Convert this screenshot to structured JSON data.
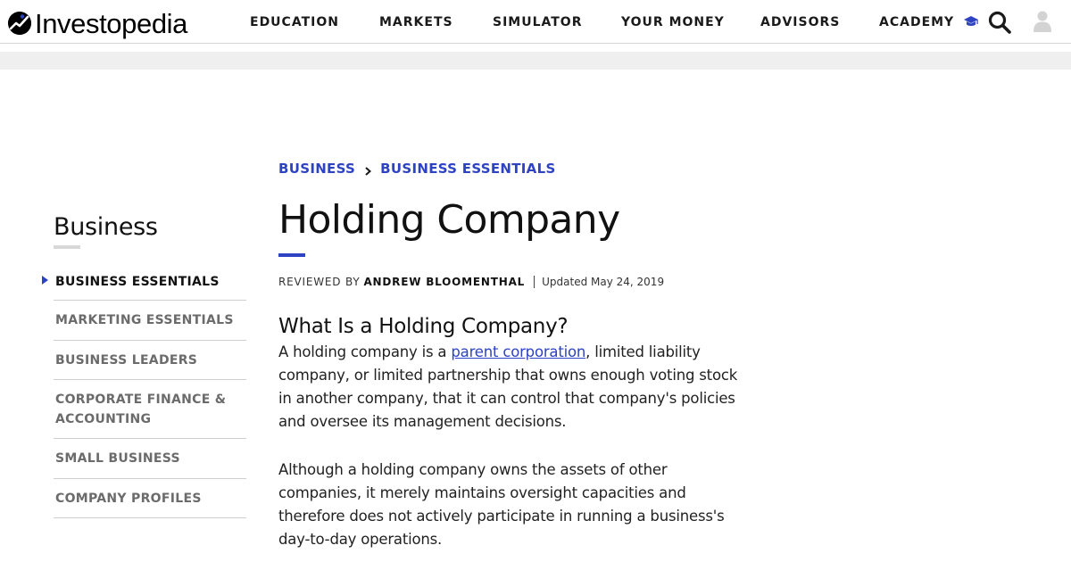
{
  "header": {
    "logo_text": "Investopedia",
    "nav": [
      {
        "label": "EDUCATION"
      },
      {
        "label": "MARKETS"
      },
      {
        "label": "SIMULATOR"
      },
      {
        "label": "YOUR MONEY"
      },
      {
        "label": "ADVISORS"
      },
      {
        "label": "ACADEMY"
      }
    ],
    "icons": {
      "academy": "graduation-cap-icon",
      "search": "search-icon",
      "user": "user-icon"
    },
    "colors": {
      "accent": "#2e42c4"
    }
  },
  "sidebar": {
    "title": "Business",
    "items": [
      {
        "label": "BUSINESS ESSENTIALS",
        "active": true
      },
      {
        "label": "MARKETING ESSENTIALS"
      },
      {
        "label": "BUSINESS LEADERS"
      },
      {
        "label": "CORPORATE FINANCE &",
        "label2": "ACCOUNTING"
      },
      {
        "label": "SMALL BUSINESS"
      },
      {
        "label": "COMPANY PROFILES"
      }
    ]
  },
  "article": {
    "breadcrumb": [
      "BUSINESS",
      "BUSINESS ESSENTIALS"
    ],
    "title": "Holding Company",
    "reviewed_by_label": "REVIEWED BY",
    "reviewer": "ANDREW BLOOMENTHAL",
    "updated": "Updated May 24, 2019",
    "section_heading": "What Is a Holding Company?",
    "para1_before": "A holding company is a ",
    "para1_link": "parent corporation",
    "para1_after": ", limited liability company, or limited partnership that owns enough voting stock in another company, that it can control that company's policies and oversee its management decisions.",
    "para2": "Although a holding company owns the assets of other companies, it merely maintains oversight capacities and therefore does not actively participate in running a business's day-to-day operations."
  }
}
